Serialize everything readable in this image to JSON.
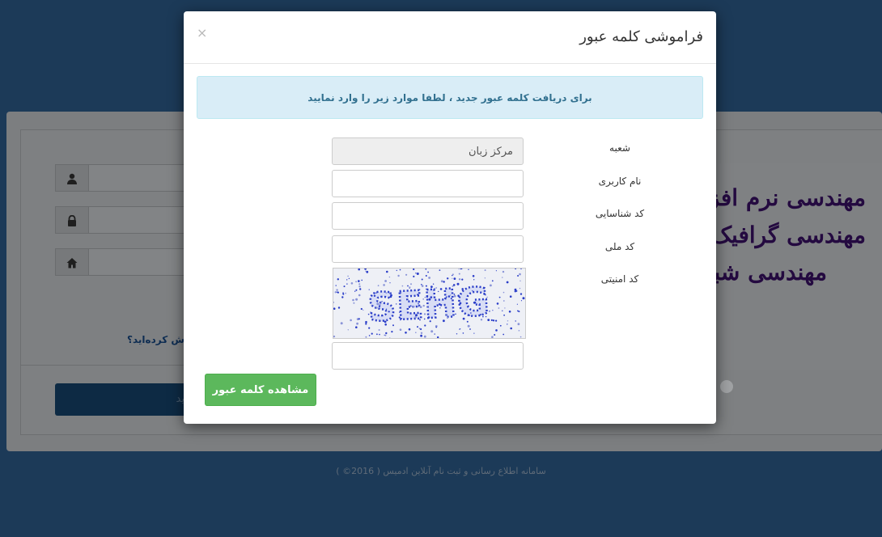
{
  "background": {
    "link_text": "ش کرده‌اید؟",
    "login_button": "ید",
    "ad_lines": [
      "مهندسی نرم افزا",
      "مهندسی گرافیک",
      "مهندسی شبک"
    ],
    "footer": "سامانه اطلاع رسانی و ثبت نام آنلاین ادمیس ( 2016© )",
    "icons": [
      "user-icon",
      "lock-icon",
      "home-icon"
    ]
  },
  "modal": {
    "title": "فراموشی کلمه عبور",
    "close": "×",
    "alert": "برای دریافت کلمه عبور جدید ، لطفا موارد زیر را وارد نمایید",
    "fields": [
      {
        "label": "شعبه",
        "value": "مرکز زبان",
        "readonly": true
      },
      {
        "label": "نام کاربری",
        "value": ""
      },
      {
        "label": "کد شناسایی",
        "value": ""
      },
      {
        "label": "کد ملی",
        "value": ""
      },
      {
        "label": "کد امنیتی",
        "value": ""
      }
    ],
    "captcha_text": "SEHG",
    "submit": "مشاهده کلمه عبور"
  },
  "colors": {
    "page_bg": "#1c3a58",
    "alert_bg": "#d9edf7",
    "alert_text": "#31708f",
    "submit_bg": "#5cb85c",
    "captcha_text": "#2b3ec8"
  }
}
